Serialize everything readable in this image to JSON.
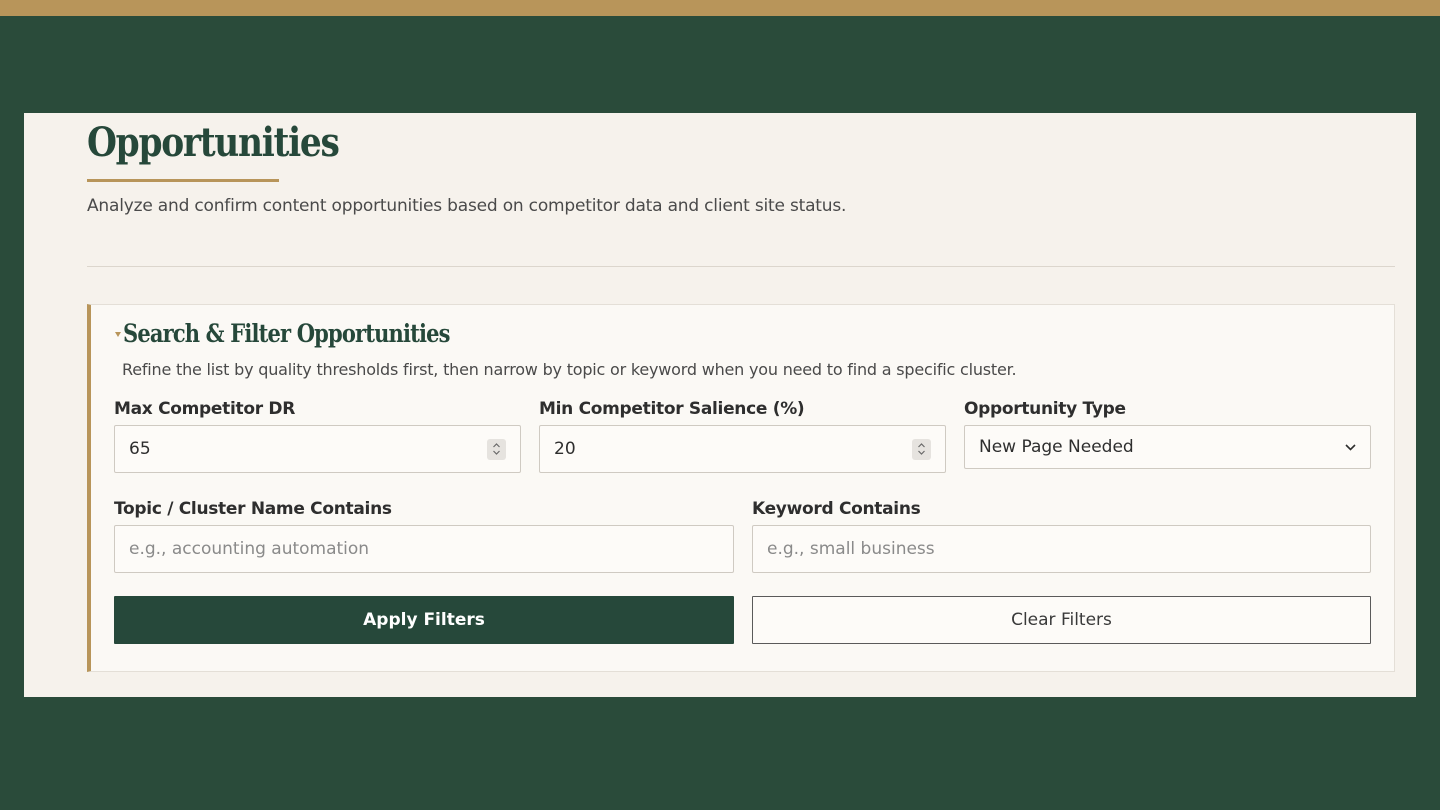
{
  "page": {
    "title": "Opportunities",
    "subtitle": "Analyze and confirm content opportunities based on competitor data and client site status."
  },
  "filters": {
    "title": "Search & Filter Opportunities",
    "description": "Refine the list by quality thresholds first, then narrow by topic or keyword when you need to find a specific cluster.",
    "max_dr": {
      "label": "Max Competitor DR",
      "value": "65"
    },
    "min_salience": {
      "label": "Min Competitor Salience (%)",
      "value": "20"
    },
    "opportunity_type": {
      "label": "Opportunity Type",
      "value": "New Page Needed"
    },
    "topic": {
      "label": "Topic / Cluster Name Contains",
      "placeholder": "e.g., accounting automation"
    },
    "keyword": {
      "label": "Keyword Contains",
      "placeholder": "e.g., small business"
    },
    "apply_label": "Apply Filters",
    "clear_label": "Clear Filters"
  },
  "colors": {
    "background": "#2a4b3a",
    "accent": "#b8955a",
    "panel": "#f6f2ec",
    "primary": "#26483a"
  }
}
